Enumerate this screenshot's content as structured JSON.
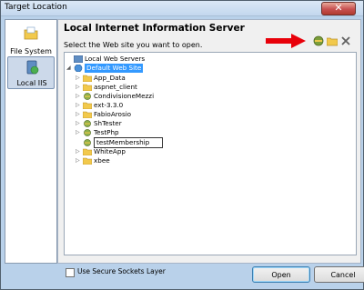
{
  "window": {
    "title": "Target Location",
    "close_symbol": "✕"
  },
  "sidebar": {
    "items": [
      {
        "label": "File System",
        "icon": "folder-icon"
      },
      {
        "label": "Local IIS",
        "icon": "server-icon"
      }
    ]
  },
  "main": {
    "heading": "Local Internet Information Server",
    "instruction": "Select the Web site you want to open."
  },
  "toolbar": {
    "icons": [
      "create-web-application-icon",
      "create-virtual-directory-icon",
      "delete-icon"
    ]
  },
  "tree": {
    "root": "Local Web Servers",
    "site": "Default Web Site",
    "items": [
      {
        "label": "App_Data",
        "icon": "folder"
      },
      {
        "label": "aspnet_client",
        "icon": "folder"
      },
      {
        "label": "CondivisioneMezzi",
        "icon": "web-app"
      },
      {
        "label": "ext-3.3.0",
        "icon": "folder"
      },
      {
        "label": "FabioArosio",
        "icon": "folder"
      },
      {
        "label": "ShTester",
        "icon": "web-app"
      },
      {
        "label": "TestPhp",
        "icon": "web-app"
      },
      {
        "label": "testMembership",
        "icon": "web-app",
        "editing": true
      },
      {
        "label": "WhiteApp",
        "icon": "folder"
      },
      {
        "label": "xbee",
        "icon": "folder"
      }
    ]
  },
  "options": {
    "secure_sockets_label": "Use Secure Sockets Layer",
    "secure_sockets_checked": false
  },
  "buttons": {
    "open": "Open",
    "cancel": "Cancel"
  },
  "colors": {
    "selection": "#3399ff",
    "arrow": "#e8000a",
    "frame": "#b9d1ea"
  }
}
